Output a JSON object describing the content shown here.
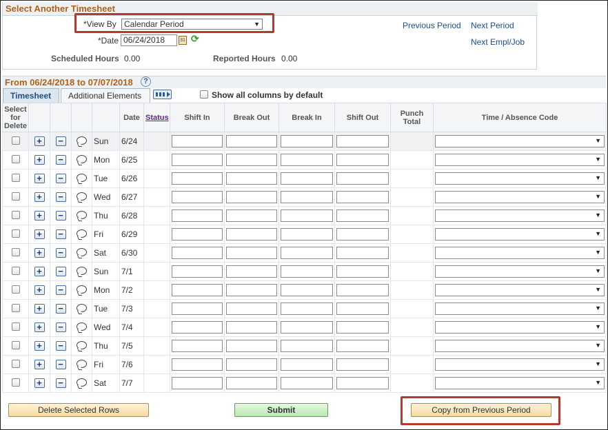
{
  "header": {
    "title": "Select Another Timesheet",
    "view_by_label": "*View By",
    "view_by_value": "Calendar Period",
    "date_label": "*Date",
    "date_value": "06/24/2018",
    "scheduled_hours_label": "Scheduled Hours",
    "scheduled_hours_value": "0.00",
    "reported_hours_label": "Reported Hours",
    "reported_hours_value": "0.00",
    "links": {
      "previous_period": "Previous Period",
      "next_period": "Next Period",
      "next_empl_job": "Next Empl/Job"
    }
  },
  "period": {
    "title": "From 06/24/2018 to 07/07/2018",
    "help": "?",
    "tabs": [
      "Timesheet",
      "Additional Elements"
    ],
    "show_all_columns_label": "Show all columns by default"
  },
  "columns": {
    "select_for_delete": "Select for Delete",
    "date": "Date",
    "status": "Status",
    "shift_in": "Shift In",
    "break_out": "Break Out",
    "break_in": "Break In",
    "shift_out": "Shift Out",
    "punch_total": "Punch Total",
    "time_absence_code": "Time / Absence Code"
  },
  "icons": {
    "add": "+",
    "remove": "−",
    "calendar": "31",
    "refresh": "⟳",
    "dropdown": "▼"
  },
  "rows": [
    {
      "day": "Sun",
      "date": "6/24"
    },
    {
      "day": "Mon",
      "date": "6/25"
    },
    {
      "day": "Tue",
      "date": "6/26"
    },
    {
      "day": "Wed",
      "date": "6/27"
    },
    {
      "day": "Thu",
      "date": "6/28"
    },
    {
      "day": "Fri",
      "date": "6/29"
    },
    {
      "day": "Sat",
      "date": "6/30"
    },
    {
      "day": "Sun",
      "date": "7/1"
    },
    {
      "day": "Mon",
      "date": "7/2"
    },
    {
      "day": "Tue",
      "date": "7/3"
    },
    {
      "day": "Wed",
      "date": "7/4"
    },
    {
      "day": "Thu",
      "date": "7/5"
    },
    {
      "day": "Fri",
      "date": "7/6"
    },
    {
      "day": "Sat",
      "date": "7/7"
    }
  ],
  "buttons": {
    "delete_selected_rows": "Delete Selected Rows",
    "submit": "Submit",
    "copy_from_previous": "Copy from Previous Period"
  },
  "colors": {
    "section_title": "#b35f16",
    "link": "#1d4d8f",
    "highlight_box": "#b23a31"
  }
}
